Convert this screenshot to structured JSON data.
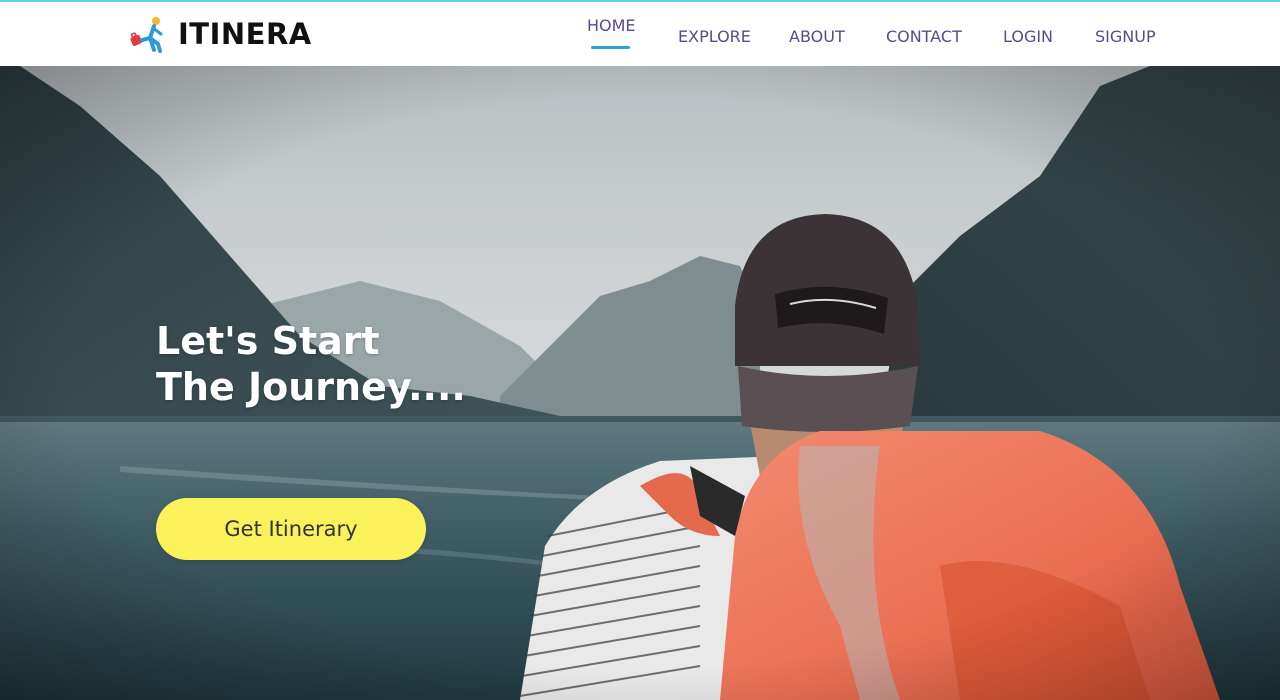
{
  "brand": {
    "name": "ITINERA",
    "logo_icon": "traveler-with-suitcase-icon"
  },
  "nav": {
    "items": [
      {
        "label": "HOME",
        "active": true
      },
      {
        "label": "EXPLORE",
        "active": false
      },
      {
        "label": "ABOUT",
        "active": false
      },
      {
        "label": "CONTACT",
        "active": false
      },
      {
        "label": "LOGIN",
        "active": false
      },
      {
        "label": "SIGNUP",
        "active": false
      }
    ]
  },
  "hero": {
    "headline_line1": "Let's Start",
    "headline_line2": "The Journey....",
    "cta_label": "Get Itinerary"
  },
  "colors": {
    "nav_text": "#5b4a8a",
    "active_underline": "#2e9fd3",
    "cta_background": "#fbf15a",
    "top_border": "#5fd3e6",
    "backpack": "#f07a5f"
  }
}
